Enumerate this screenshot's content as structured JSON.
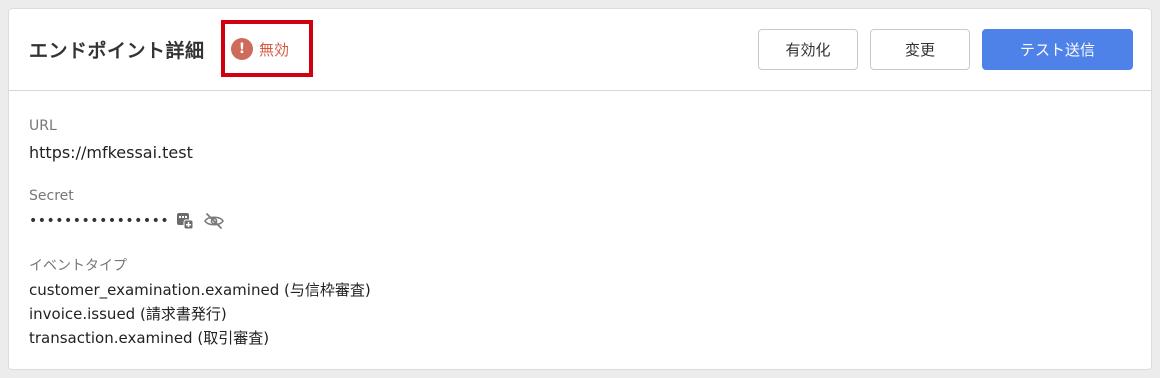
{
  "header": {
    "title": "エンドポイント詳細",
    "status": {
      "icon": "exclamation-icon",
      "label": "無効",
      "color": "#d55a45"
    },
    "buttons": {
      "enable_label": "有効化",
      "edit_label": "変更",
      "test_label": "テスト送信"
    }
  },
  "details": {
    "url": {
      "label": "URL",
      "value": "https://mfkessai.test"
    },
    "secret": {
      "label": "Secret",
      "masked_value": "••••••••••••••••",
      "copy_icon": "copy-icon",
      "toggle_icon": "eye-off-icon"
    },
    "event_types": {
      "label": "イベントタイプ",
      "items": [
        "customer_examination.examined (与信枠審査)",
        "invoice.issued (請求書発行)",
        "transaction.examined (取引審査)"
      ]
    }
  },
  "colors": {
    "accent": "#4f82e8",
    "highlight_box": "#d1000f"
  }
}
